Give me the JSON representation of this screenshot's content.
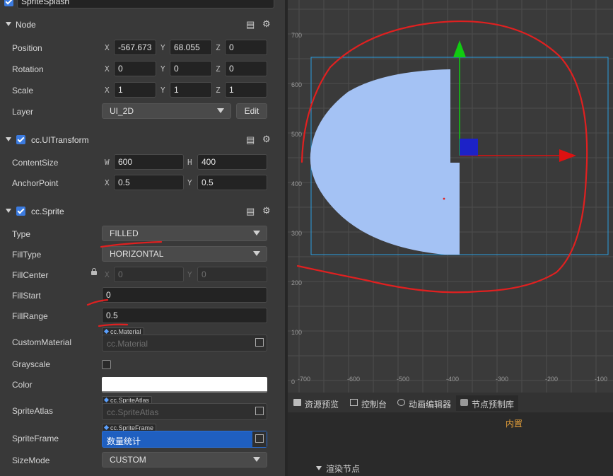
{
  "node_name": "SpriteSplash",
  "node_section": {
    "title": "Node",
    "book_icon": "book-icon",
    "gear_icon": "gear-icon"
  },
  "position": {
    "label": "Position",
    "x": "-567.673",
    "y": "68.055",
    "z": "0"
  },
  "rotation": {
    "label": "Rotation",
    "x": "0",
    "y": "0",
    "z": "0"
  },
  "scale": {
    "label": "Scale",
    "x": "1",
    "y": "1",
    "z": "1"
  },
  "layer": {
    "label": "Layer",
    "value": "UI_2D",
    "edit": "Edit"
  },
  "uitransform": {
    "title": "cc.UITransform",
    "content_size": {
      "label": "ContentSize",
      "w": "600",
      "h": "400"
    },
    "anchor_point": {
      "label": "AnchorPoint",
      "x": "0.5",
      "y": "0.5"
    }
  },
  "sprite": {
    "title": "cc.Sprite",
    "type": {
      "label": "Type",
      "value": "FILLED"
    },
    "fill_type": {
      "label": "FillType",
      "value": "HORIZONTAL"
    },
    "fill_center": {
      "label": "FillCenter",
      "x": "0",
      "y": "0"
    },
    "fill_start": {
      "label": "FillStart",
      "value": "0"
    },
    "fill_range": {
      "label": "FillRange",
      "value": "0.5"
    },
    "custom_material": {
      "label": "CustomMaterial",
      "tag": "cc.Material",
      "placeholder": "cc.Material"
    },
    "grayscale": {
      "label": "Grayscale",
      "checked": false
    },
    "color": {
      "label": "Color",
      "value": "#FFFFFF"
    },
    "sprite_atlas": {
      "label": "SpriteAtlas",
      "tag": "cc.SpriteAtlas",
      "placeholder": "cc.SpriteAtlas"
    },
    "sprite_frame": {
      "label": "SpriteFrame",
      "tag": "cc.SpriteFrame",
      "value": "数量统计"
    },
    "size_mode": {
      "label": "SizeMode",
      "value": "CUSTOM"
    }
  },
  "axes": {
    "x": "X",
    "y": "Y",
    "z": "Z",
    "w": "W",
    "h": "H"
  },
  "scene": {
    "y_ticks": [
      "700",
      "600",
      "500",
      "400",
      "300",
      "200",
      "100",
      "0"
    ],
    "x_ticks": [
      "-700",
      "-600",
      "-500",
      "-400",
      "-300",
      "-200",
      "-100"
    ],
    "sprite_fill_color": "#a4c2f4",
    "gizmo_x_color": "#dd1111",
    "gizmo_y_color": "#11cc11"
  },
  "bottom_tabs": [
    "资源预览",
    "控制台",
    "动画编辑器",
    "节点预制库"
  ],
  "bottom_panel": {
    "builtin_label": "内置",
    "tree_item": "渲染节点"
  }
}
